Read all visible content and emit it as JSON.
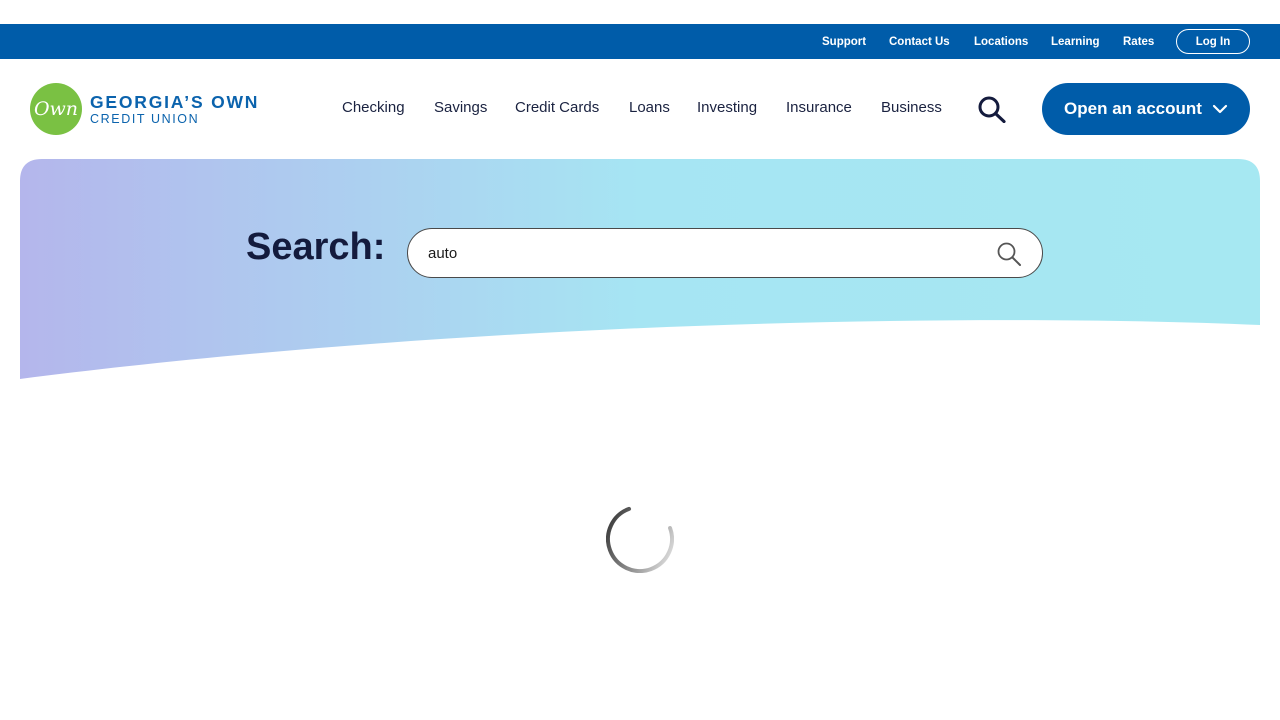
{
  "utility_nav": {
    "links": [
      {
        "label": "Support"
      },
      {
        "label": "Contact Us"
      },
      {
        "label": "Locations"
      },
      {
        "label": "Learning"
      },
      {
        "label": "Rates"
      }
    ],
    "login_label": "Log In"
  },
  "brand": {
    "logo_mark": "Own",
    "name_line1": "GEORGIA’S OWN",
    "name_line2": "CREDIT UNION",
    "color_primary": "#005ca9",
    "color_logo_green": "#7ac143"
  },
  "main_nav": {
    "items": [
      {
        "label": "Checking"
      },
      {
        "label": "Savings"
      },
      {
        "label": "Credit Cards"
      },
      {
        "label": "Loans"
      },
      {
        "label": "Investing"
      },
      {
        "label": "Insurance"
      },
      {
        "label": "Business"
      }
    ],
    "search_icon": "search-icon",
    "cta_label": "Open an account",
    "cta_icon": "chevron-down-icon"
  },
  "hero": {
    "search_label": "Search:",
    "search_value": "auto",
    "search_icon": "search-icon",
    "gradient_start": "#b4b6ec",
    "gradient_end": "#a6e8f2"
  },
  "results": {
    "loading_icon": "loading-spinner-icon"
  }
}
